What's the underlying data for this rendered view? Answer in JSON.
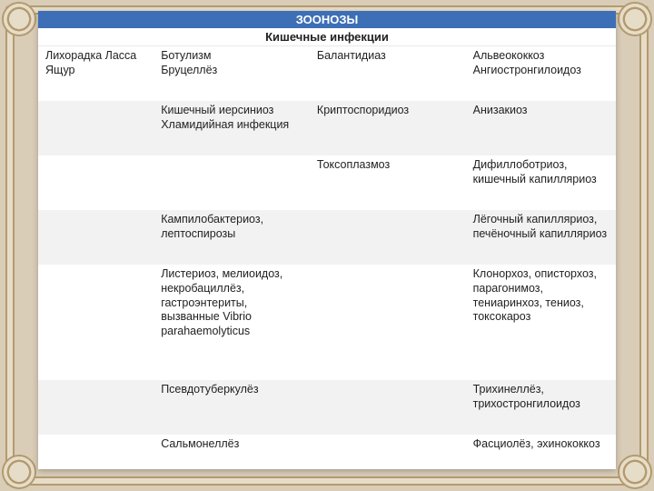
{
  "header": {
    "title": "ЗООНОЗЫ",
    "subtitle": "Кишечные инфекции"
  },
  "rows": [
    {
      "c1": "Лихорадка Ласса\nЯщур",
      "c2": "Ботулизм\nБруцеллёз",
      "c3": "Балантидиаз",
      "c4": "Альвеококкоз\nАнгиостронгилоидоз"
    },
    {
      "c1": "",
      "c2": "Кишечный иерсиниоз\nХламидийная инфекция",
      "c3": "Криптоспоридиоз",
      "c4": "Анизакиоз"
    },
    {
      "c1": "",
      "c2": "",
      "c3": "Токсоплазмоз",
      "c4": "Дифиллоботриоз, кишечный капилляриоз"
    },
    {
      "c1": "",
      "c2": "Кампилобактериоз, лептоспирозы",
      "c3": "",
      "c4": "Лёгочный капилляриоз, печёночный капилляриоз"
    },
    {
      "c1": "",
      "c2": "Листериоз, мелиоидоз, некробациллёз, гастроэнтериты, вызванные Vibrio parahaemolyticus",
      "c3": "",
      "c4": "Клонорхоз, описторхоз, парагонимоз, тениаринхоз, тениоз, токсокароз"
    },
    {
      "c1": "",
      "c2": "Псевдотуберкулёз",
      "c3": "",
      "c4": "Трихинеллёз, трихостронгилоидоз"
    },
    {
      "c1": "",
      "c2": "Сальмонеллёз",
      "c3": "",
      "c4": "Фасциолёз, эхинококкоз"
    }
  ]
}
